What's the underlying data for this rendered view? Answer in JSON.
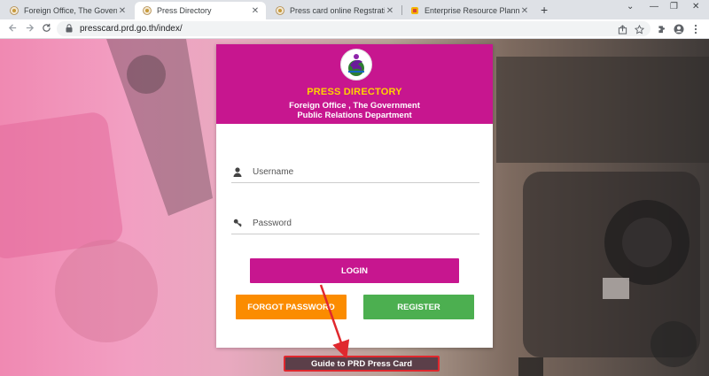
{
  "browser": {
    "tabs": [
      {
        "title": "Foreign Office, The Government P",
        "active": false
      },
      {
        "title": "Press Directory",
        "active": true
      },
      {
        "title": "Press card online Regstration",
        "active": false
      },
      {
        "title": "Enterprise Resource Planning - R",
        "active": false
      }
    ],
    "close_glyph": "✕",
    "new_tab_glyph": "+",
    "url": "presscard.prd.go.th/index/",
    "window_controls": [
      "⌄",
      "—",
      "❐",
      "✕"
    ]
  },
  "header": {
    "title": "PRESS DIRECTORY",
    "subtitle_line1": "Foreign Office , The Government",
    "subtitle_line2": "Public Relations Department"
  },
  "form": {
    "username_placeholder": "Username",
    "password_placeholder": "Password",
    "login_label": "LOGIN",
    "forgot_label": "FORGOT PASSWORD",
    "register_label": "REGISTER"
  },
  "guide_label": "Guide to PRD Press Card",
  "colors": {
    "header_bg": "#c7168f",
    "title": "#ffd200",
    "login": "#c7168f",
    "forgot": "#fb8c00",
    "register": "#4caf50",
    "annotation": "#e0282e"
  }
}
